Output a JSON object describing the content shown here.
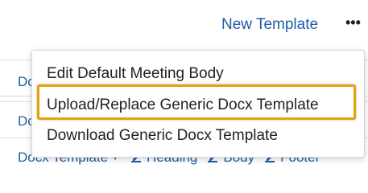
{
  "header": {
    "new_template_label": "New Template",
    "more_icon": "more-horizontal-icon"
  },
  "background": {
    "row1_text": "Dc",
    "row2_text": "Dc",
    "bottom_row": {
      "docx_template_label": "Docx Template",
      "heading_label": "Heading",
      "body_label": "Body",
      "footer_label": "Footer"
    }
  },
  "menu": {
    "items": [
      {
        "label": "Edit Default Meeting Body"
      },
      {
        "label": "Upload/Replace Generic Docx Template",
        "highlighted": true
      },
      {
        "label": "Download Generic Docx Template"
      }
    ]
  },
  "colors": {
    "link": "#1f5ea8",
    "highlight_border": "#e3a20a"
  }
}
